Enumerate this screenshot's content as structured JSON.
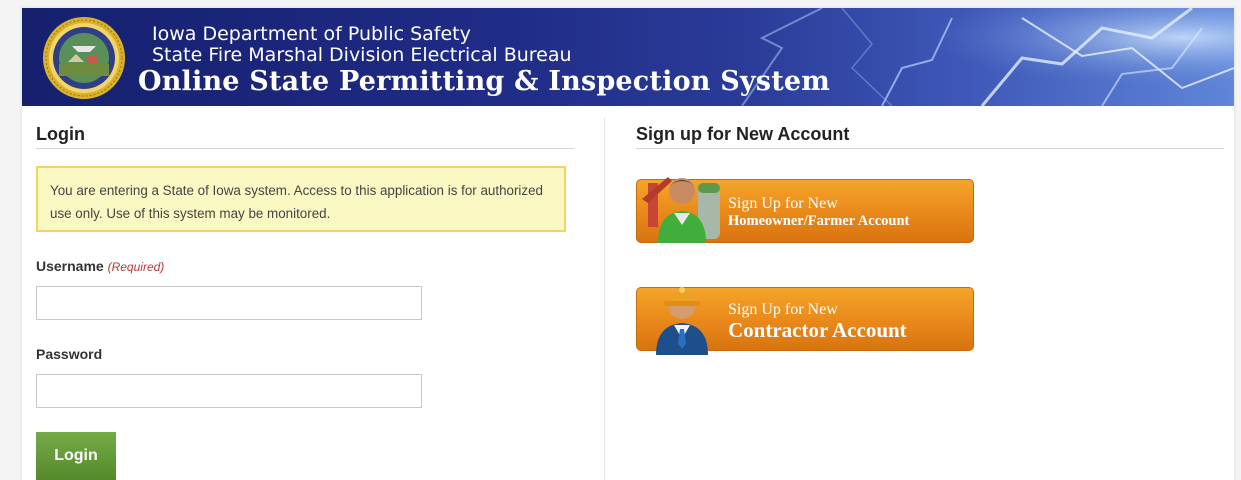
{
  "banner": {
    "line1": "Iowa Department of Public Safety",
    "line2": "State Fire Marshal Division Electrical Bureau",
    "title": "Online State Permitting & Inspection System",
    "colors": {
      "dark_blue": "#16206e",
      "light_blue": "#5f86d8",
      "seal_gold": "#d9b12c"
    }
  },
  "login": {
    "heading": "Login",
    "notice": "You are entering a State of Iowa system. Access to this application is for authorized use only. Use of this system may be monitored.",
    "username_label": "Username",
    "required_text": "(Required)",
    "username_value": "",
    "password_label": "Password",
    "password_value": "",
    "submit_label": "Login",
    "colors": {
      "notice_bg": "#fcf8c4",
      "notice_border": "#f1d561",
      "button_green": "#5e9432",
      "required_red": "#b53a3a"
    }
  },
  "signup": {
    "heading": "Sign up for New Account",
    "homeowner": {
      "line1": "Sign Up for New",
      "line2": "Homeowner/Farmer Account",
      "icon": "homeowner-farmer-icon"
    },
    "contractor": {
      "line1": "Sign Up for New",
      "line2": "Contractor Account",
      "icon": "contractor-worker-icon"
    },
    "colors": {
      "button_orange": "#e8881a"
    }
  }
}
